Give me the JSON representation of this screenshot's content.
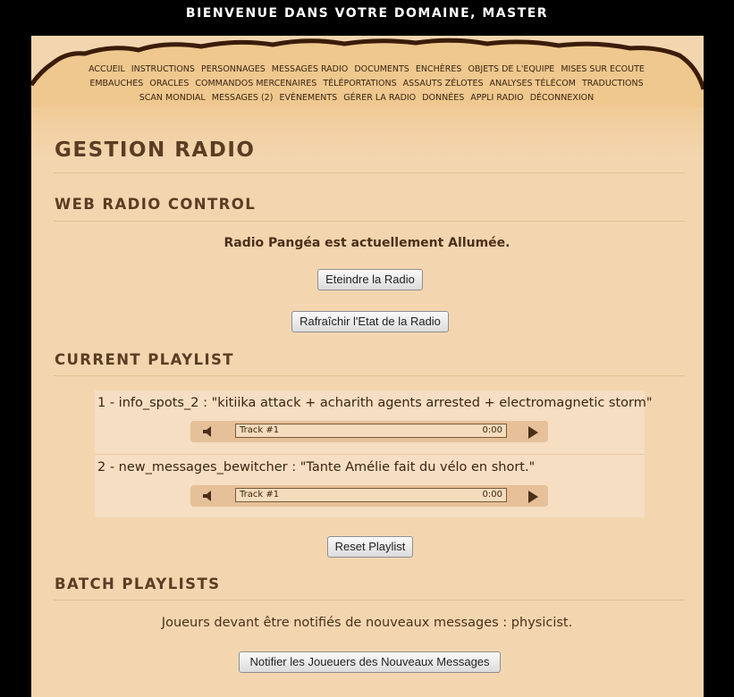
{
  "header": {
    "welcome": "BIENVENUE DANS VOTRE DOMAINE, MASTER"
  },
  "nav": {
    "rows": [
      [
        "ACCUEIL",
        "INSTRUCTIONS",
        "PERSONNAGES",
        "MESSAGES RADIO",
        "DOCUMENTS",
        "ENCHÈRES",
        "OBJETS DE L'EQUIPE",
        "MISES SUR ECOUTE"
      ],
      [
        "EMBAUCHES",
        "ORACLES",
        "COMMANDOS MERCENAIRES",
        "TÉLÉPORTATIONS",
        "ASSAUTS ZÉLOTES",
        "ANALYSES TÉLÉCOM",
        "TRADUCTIONS"
      ],
      [
        "SCAN MONDIAL",
        "MESSAGES (2)",
        "EVÈNEMENTS",
        "GÉRER LA RADIO",
        "DONNÉES",
        "APPLI RADIO",
        "DÉCONNEXION"
      ]
    ]
  },
  "page": {
    "title": "GESTION RADIO"
  },
  "web_radio": {
    "heading": "WEB RADIO CONTROL",
    "status": "Radio Pangéa est actuellement Allumée.",
    "off_button": "Eteindre la Radio",
    "refresh_button": "Rafraîchir l'Etat de la Radio"
  },
  "playlist": {
    "heading": "CURRENT PLAYLIST",
    "tracks": [
      {
        "title": "1 - info_spots_2 : \"kitiika attack + acharith agents arrested + electromagnetic storm\"",
        "player_label": "Track #1",
        "time": "0:00"
      },
      {
        "title": "2 - new_messages_bewitcher : \"Tante Amélie fait du vélo en short.\"",
        "player_label": "Track #1",
        "time": "0:00"
      }
    ],
    "reset_button": "Reset Playlist"
  },
  "batch": {
    "heading": "BATCH PLAYLISTS",
    "notify_text": "Joueurs devant être notifiés de nouveaux messages : physicist.",
    "notify_button": "Notifier les Joueuers des Nouveaux Messages"
  }
}
